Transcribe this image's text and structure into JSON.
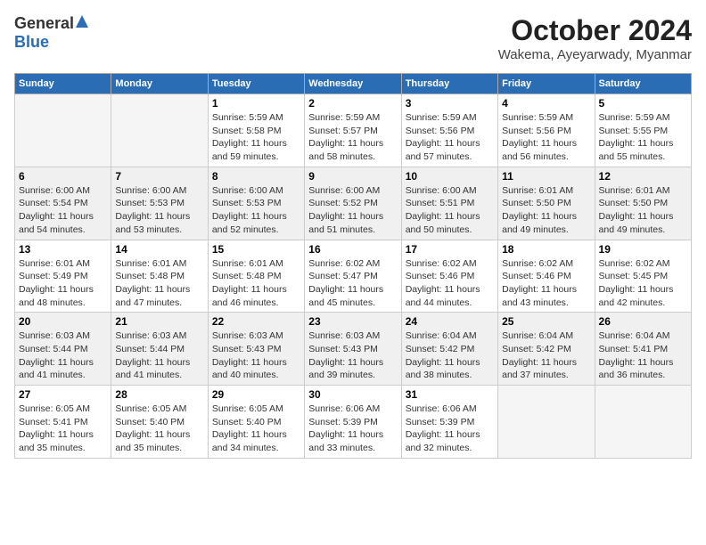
{
  "header": {
    "logo_general": "General",
    "logo_blue": "Blue",
    "month_title": "October 2024",
    "location": "Wakema, Ayeyarwady, Myanmar"
  },
  "days_of_week": [
    "Sunday",
    "Monday",
    "Tuesday",
    "Wednesday",
    "Thursday",
    "Friday",
    "Saturday"
  ],
  "weeks": [
    [
      {
        "num": "",
        "sunrise": "",
        "sunset": "",
        "daylight": "",
        "empty": true
      },
      {
        "num": "",
        "sunrise": "",
        "sunset": "",
        "daylight": "",
        "empty": true
      },
      {
        "num": "1",
        "sunrise": "Sunrise: 5:59 AM",
        "sunset": "Sunset: 5:58 PM",
        "daylight": "Daylight: 11 hours and 59 minutes.",
        "empty": false
      },
      {
        "num": "2",
        "sunrise": "Sunrise: 5:59 AM",
        "sunset": "Sunset: 5:57 PM",
        "daylight": "Daylight: 11 hours and 58 minutes.",
        "empty": false
      },
      {
        "num": "3",
        "sunrise": "Sunrise: 5:59 AM",
        "sunset": "Sunset: 5:56 PM",
        "daylight": "Daylight: 11 hours and 57 minutes.",
        "empty": false
      },
      {
        "num": "4",
        "sunrise": "Sunrise: 5:59 AM",
        "sunset": "Sunset: 5:56 PM",
        "daylight": "Daylight: 11 hours and 56 minutes.",
        "empty": false
      },
      {
        "num": "5",
        "sunrise": "Sunrise: 5:59 AM",
        "sunset": "Sunset: 5:55 PM",
        "daylight": "Daylight: 11 hours and 55 minutes.",
        "empty": false
      }
    ],
    [
      {
        "num": "6",
        "sunrise": "Sunrise: 6:00 AM",
        "sunset": "Sunset: 5:54 PM",
        "daylight": "Daylight: 11 hours and 54 minutes.",
        "empty": false
      },
      {
        "num": "7",
        "sunrise": "Sunrise: 6:00 AM",
        "sunset": "Sunset: 5:53 PM",
        "daylight": "Daylight: 11 hours and 53 minutes.",
        "empty": false
      },
      {
        "num": "8",
        "sunrise": "Sunrise: 6:00 AM",
        "sunset": "Sunset: 5:53 PM",
        "daylight": "Daylight: 11 hours and 52 minutes.",
        "empty": false
      },
      {
        "num": "9",
        "sunrise": "Sunrise: 6:00 AM",
        "sunset": "Sunset: 5:52 PM",
        "daylight": "Daylight: 11 hours and 51 minutes.",
        "empty": false
      },
      {
        "num": "10",
        "sunrise": "Sunrise: 6:00 AM",
        "sunset": "Sunset: 5:51 PM",
        "daylight": "Daylight: 11 hours and 50 minutes.",
        "empty": false
      },
      {
        "num": "11",
        "sunrise": "Sunrise: 6:01 AM",
        "sunset": "Sunset: 5:50 PM",
        "daylight": "Daylight: 11 hours and 49 minutes.",
        "empty": false
      },
      {
        "num": "12",
        "sunrise": "Sunrise: 6:01 AM",
        "sunset": "Sunset: 5:50 PM",
        "daylight": "Daylight: 11 hours and 49 minutes.",
        "empty": false
      }
    ],
    [
      {
        "num": "13",
        "sunrise": "Sunrise: 6:01 AM",
        "sunset": "Sunset: 5:49 PM",
        "daylight": "Daylight: 11 hours and 48 minutes.",
        "empty": false
      },
      {
        "num": "14",
        "sunrise": "Sunrise: 6:01 AM",
        "sunset": "Sunset: 5:48 PM",
        "daylight": "Daylight: 11 hours and 47 minutes.",
        "empty": false
      },
      {
        "num": "15",
        "sunrise": "Sunrise: 6:01 AM",
        "sunset": "Sunset: 5:48 PM",
        "daylight": "Daylight: 11 hours and 46 minutes.",
        "empty": false
      },
      {
        "num": "16",
        "sunrise": "Sunrise: 6:02 AM",
        "sunset": "Sunset: 5:47 PM",
        "daylight": "Daylight: 11 hours and 45 minutes.",
        "empty": false
      },
      {
        "num": "17",
        "sunrise": "Sunrise: 6:02 AM",
        "sunset": "Sunset: 5:46 PM",
        "daylight": "Daylight: 11 hours and 44 minutes.",
        "empty": false
      },
      {
        "num": "18",
        "sunrise": "Sunrise: 6:02 AM",
        "sunset": "Sunset: 5:46 PM",
        "daylight": "Daylight: 11 hours and 43 minutes.",
        "empty": false
      },
      {
        "num": "19",
        "sunrise": "Sunrise: 6:02 AM",
        "sunset": "Sunset: 5:45 PM",
        "daylight": "Daylight: 11 hours and 42 minutes.",
        "empty": false
      }
    ],
    [
      {
        "num": "20",
        "sunrise": "Sunrise: 6:03 AM",
        "sunset": "Sunset: 5:44 PM",
        "daylight": "Daylight: 11 hours and 41 minutes.",
        "empty": false
      },
      {
        "num": "21",
        "sunrise": "Sunrise: 6:03 AM",
        "sunset": "Sunset: 5:44 PM",
        "daylight": "Daylight: 11 hours and 41 minutes.",
        "empty": false
      },
      {
        "num": "22",
        "sunrise": "Sunrise: 6:03 AM",
        "sunset": "Sunset: 5:43 PM",
        "daylight": "Daylight: 11 hours and 40 minutes.",
        "empty": false
      },
      {
        "num": "23",
        "sunrise": "Sunrise: 6:03 AM",
        "sunset": "Sunset: 5:43 PM",
        "daylight": "Daylight: 11 hours and 39 minutes.",
        "empty": false
      },
      {
        "num": "24",
        "sunrise": "Sunrise: 6:04 AM",
        "sunset": "Sunset: 5:42 PM",
        "daylight": "Daylight: 11 hours and 38 minutes.",
        "empty": false
      },
      {
        "num": "25",
        "sunrise": "Sunrise: 6:04 AM",
        "sunset": "Sunset: 5:42 PM",
        "daylight": "Daylight: 11 hours and 37 minutes.",
        "empty": false
      },
      {
        "num": "26",
        "sunrise": "Sunrise: 6:04 AM",
        "sunset": "Sunset: 5:41 PM",
        "daylight": "Daylight: 11 hours and 36 minutes.",
        "empty": false
      }
    ],
    [
      {
        "num": "27",
        "sunrise": "Sunrise: 6:05 AM",
        "sunset": "Sunset: 5:41 PM",
        "daylight": "Daylight: 11 hours and 35 minutes.",
        "empty": false
      },
      {
        "num": "28",
        "sunrise": "Sunrise: 6:05 AM",
        "sunset": "Sunset: 5:40 PM",
        "daylight": "Daylight: 11 hours and 35 minutes.",
        "empty": false
      },
      {
        "num": "29",
        "sunrise": "Sunrise: 6:05 AM",
        "sunset": "Sunset: 5:40 PM",
        "daylight": "Daylight: 11 hours and 34 minutes.",
        "empty": false
      },
      {
        "num": "30",
        "sunrise": "Sunrise: 6:06 AM",
        "sunset": "Sunset: 5:39 PM",
        "daylight": "Daylight: 11 hours and 33 minutes.",
        "empty": false
      },
      {
        "num": "31",
        "sunrise": "Sunrise: 6:06 AM",
        "sunset": "Sunset: 5:39 PM",
        "daylight": "Daylight: 11 hours and 32 minutes.",
        "empty": false
      },
      {
        "num": "",
        "sunrise": "",
        "sunset": "",
        "daylight": "",
        "empty": true
      },
      {
        "num": "",
        "sunrise": "",
        "sunset": "",
        "daylight": "",
        "empty": true
      }
    ]
  ]
}
